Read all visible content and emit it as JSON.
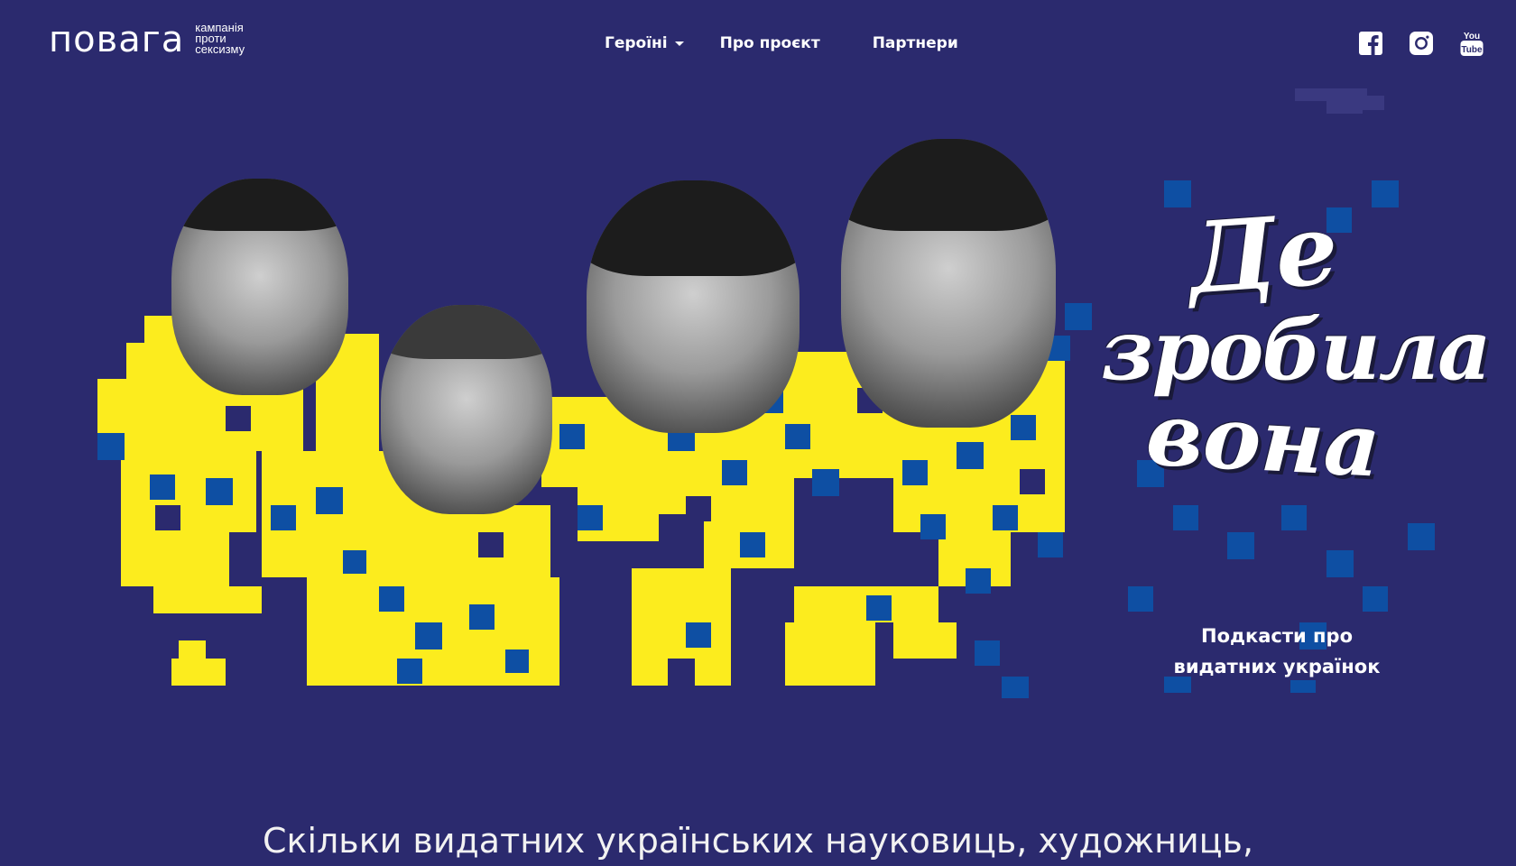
{
  "header": {
    "logo_word": "повага",
    "logo_tagline": "кампанія проти сексизму",
    "nav": [
      {
        "label": "Героїні",
        "has_dropdown": true
      },
      {
        "label": "Про проєкт"
      },
      {
        "label": "Партнери"
      }
    ],
    "socials": [
      "facebook-icon",
      "instagram-icon",
      "youtube-icon"
    ]
  },
  "hero": {
    "title_lines": [
      "Де",
      "зробила",
      "вона"
    ],
    "subtitle_line1": "Подкасти про",
    "subtitle_line2": "видатних українок"
  },
  "lead_text": "Скільки видатних українських науковиць, художниць,",
  "colors": {
    "background": "#2b2a6e",
    "accent_yellow": "#fcec1e",
    "accent_blue": "#0e4fa3",
    "text": "#ffffff"
  }
}
